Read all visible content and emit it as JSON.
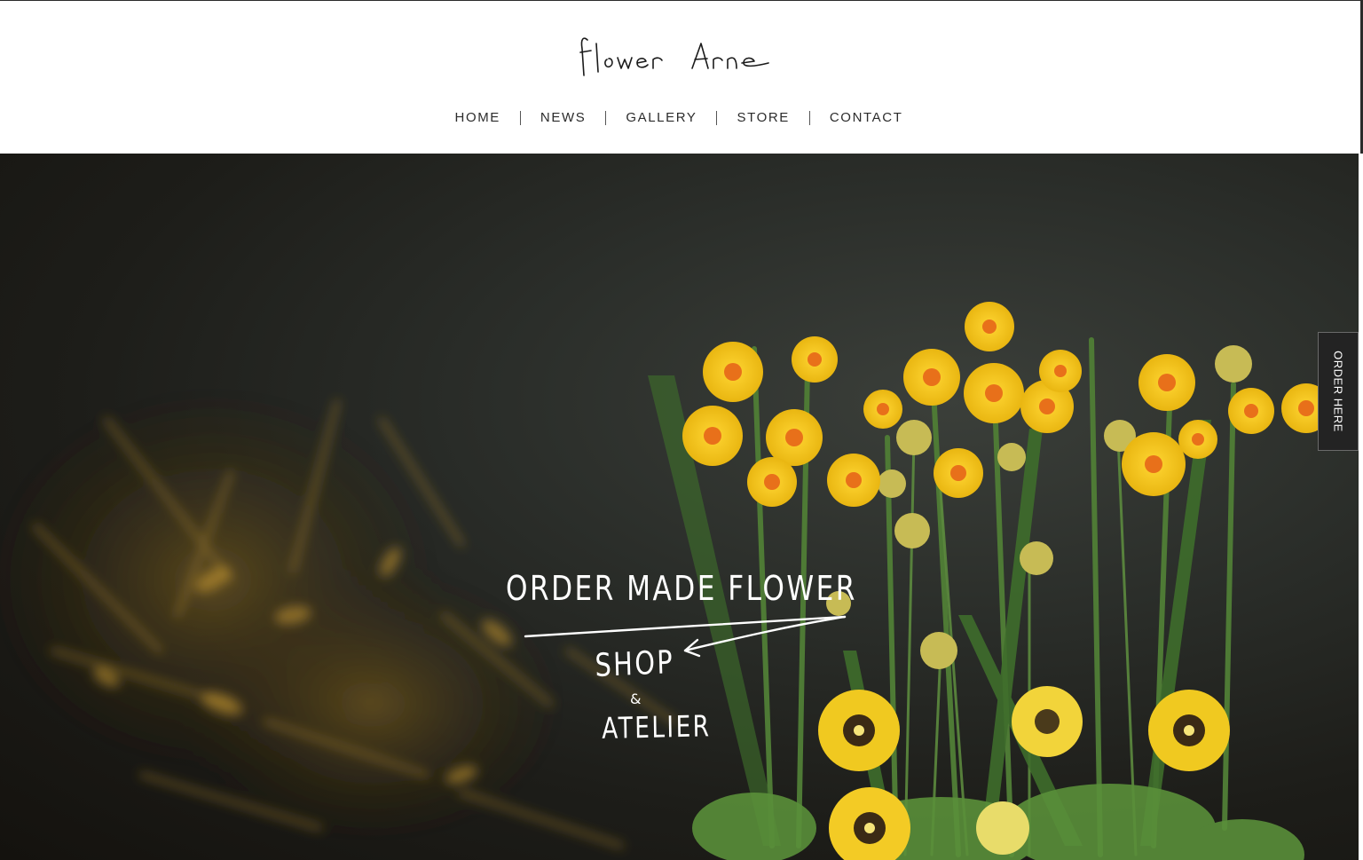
{
  "header": {
    "logo_text": "flower Arne",
    "nav": [
      {
        "label": "HOME"
      },
      {
        "label": "NEWS"
      },
      {
        "label": "GALLERY"
      },
      {
        "label": "STORE"
      },
      {
        "label": "CONTACT"
      }
    ]
  },
  "hero": {
    "headline": "ORDER MADE FLOWER",
    "sub_shop": "SHOP",
    "sub_amp": "&",
    "sub_atelier": "ATELIER"
  },
  "side_tab": {
    "label": "ORDER HERE"
  },
  "colors": {
    "hero_bg": "#1d1d19",
    "daffodil": "#f2c21a",
    "daffodil_center": "#e8701a",
    "stem": "#4e7a35",
    "tab_bg": "#232323"
  }
}
